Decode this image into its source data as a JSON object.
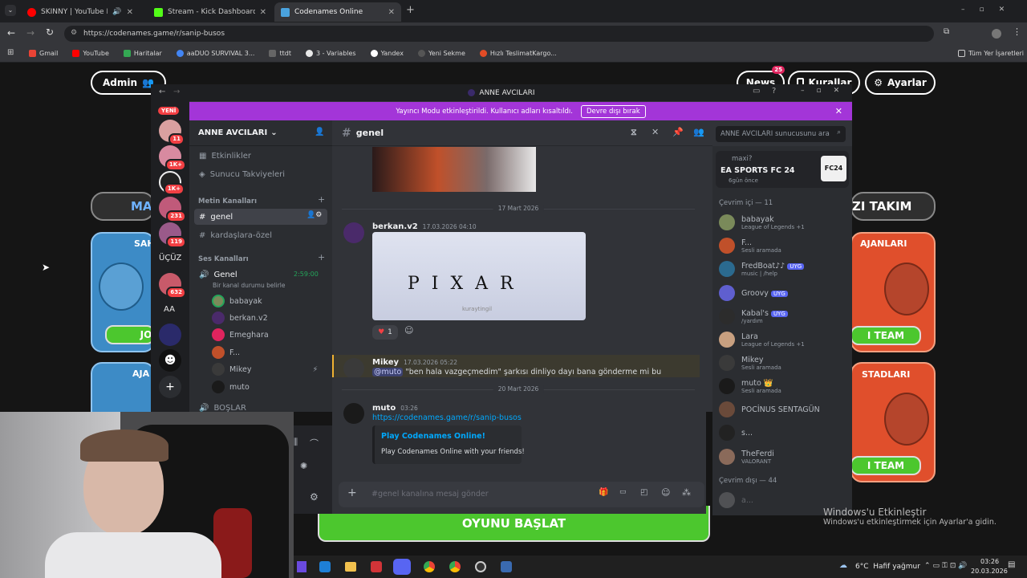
{
  "browser": {
    "tabs": [
      {
        "title": "SKINNY | YouTube Music",
        "color": "#ff0000"
      },
      {
        "title": "Stream - Kick Dashboard",
        "color": "#53fc18"
      },
      {
        "title": "Codenames Online",
        "color": "#4aa3df"
      }
    ],
    "url": "https://codenames.game/r/sanip-busos",
    "bookmarks": [
      {
        "label": "Gmail",
        "color": "#ea4335"
      },
      {
        "label": "YouTube",
        "color": "#ff0000"
      },
      {
        "label": "Haritalar",
        "color": "#34a853"
      },
      {
        "label": "aaDUO SURVIVAL 3...",
        "color": "#4285f4"
      },
      {
        "label": "ttdt",
        "color": "#666666"
      },
      {
        "label": "3 - Variables",
        "color": "#e8e8e8"
      },
      {
        "label": "Yandex",
        "color": "#ffffff"
      },
      {
        "label": "Yeni Sekme",
        "color": "#555555"
      },
      {
        "label": "Hızlı TeslimatKargo...",
        "color": "#e34c26"
      }
    ],
    "all_bookmarks": "Tüm Yer İşaretleri"
  },
  "game": {
    "admin_label": "Admin",
    "news_label": "News",
    "news_count": "25",
    "rules_label": "Kurallar",
    "settings_label": "Ayarlar",
    "left_team_label": "MA",
    "right_team_label": "ZI TAKIM",
    "left_card_header": "SAH",
    "left_join": "JO",
    "left_agents": "AJA",
    "right_agents": "AJANLARI",
    "right_team_btn": "I TEAM",
    "right_spymaster": "STADLARI",
    "right_team_btn2": "I TEAM",
    "start_button": "OYUNU BAŞLAT"
  },
  "discord": {
    "window_title": "ANNE AVCILARI",
    "banner_text": "Yayıncı Modu etkinleştirildi. Kullanıcı adları kısaltıldı.",
    "banner_button": "Devre dışı bırak",
    "server_new_label": "YENİ",
    "server_badges": [
      "11",
      "1K+",
      "1K+",
      "231",
      "119",
      "632"
    ],
    "server_text_icons": [
      "ÜÇÜZ",
      "AA"
    ],
    "server_name": "ANNE AVCILARI",
    "channels": {
      "events": "Etkinlikler",
      "boosts": "Sunucu Takviyeleri",
      "text_category": "Metin Kanalları",
      "general": "genel",
      "friends": "kardaşlara-özel",
      "voice_category": "Ses Kanalları",
      "voice_channel": "Genel",
      "voice_timer": "2:59:00",
      "voice_status": "Bir kanal durumu belirle",
      "voice_users": [
        "babayak",
        "berkan.v2",
        "Emeghara",
        "F...",
        "Mikey",
        "muto"
      ],
      "next_channel": "BOŞLAR"
    },
    "chat": {
      "channel": "genel",
      "search_placeholder": "ANNE AVCILARI sunucusunu ara",
      "date1": "17 Mart 2026",
      "msg1_user": "berkan.v2",
      "msg1_time": "17.03.2026 04:10",
      "msg1_image_text": "P I X A R",
      "msg1_image_caption": "kuraytingil",
      "msg1_reaction": "1",
      "msg2_user": "Mikey",
      "msg2_time": "17.03.2026 05:22",
      "msg2_mention": "@muto",
      "msg2_text": "\"ben hala vazgeçmedim\" şarkısı dinliyo dayı bana gönderme mi bu",
      "date2": "20 Mart 2026",
      "msg3_user": "muto",
      "msg3_time": "03:26",
      "msg3_link": "https://codenames.game/r/sanip-busos",
      "embed_title": "Play Codenames Online!",
      "embed_desc": "Play Codenames Online with your friends!",
      "composer_placeholder": "#genel kanalına mesaj gönder"
    },
    "activity": {
      "user": "maxi?",
      "game": "EA SPORTS FC 24",
      "ago": "6gün önce",
      "logo": "FC24"
    },
    "online_header": "Çevrim içi — 11",
    "members": [
      {
        "name": "babayak",
        "status": "League of Legends +1",
        "color": "#7a8a5a"
      },
      {
        "name": "F...",
        "status": "Sesli aramada",
        "color": "#c0502a"
      },
      {
        "name": "FredBoat♪♪",
        "status": "music | /help",
        "color": "#2b6a8f",
        "tag": "UYG"
      },
      {
        "name": "Groovy",
        "status": "",
        "color": "#5f5fcf",
        "tag": "UYG"
      },
      {
        "name": "Kabal's",
        "status": "/yardım",
        "color": "#2c2c2c",
        "tag": "UYG"
      },
      {
        "name": "Lara",
        "status": "League of Legends +1",
        "color": "#c8a080"
      },
      {
        "name": "Mikey",
        "status": "Sesli aramada",
        "color": "#3a3a3a"
      },
      {
        "name": "muto 👑",
        "status": "Sesli aramada",
        "color": "#1a1a1a"
      },
      {
        "name": "POCİNUS SENTAGÜN",
        "status": "",
        "color": "#6a4a3a"
      },
      {
        "name": "s...",
        "status": "",
        "color": "#222222"
      },
      {
        "name": "TheFerdi",
        "status": "VALORANT",
        "color": "#8a6a5a"
      }
    ],
    "offline_header": "Çevrim dışı — 44",
    "offline_first": "a..."
  },
  "windows": {
    "activate_title": "Windows'u Etkinleştir",
    "activate_sub": "Windows'u etkinleştirmek için Ayarlar'a gidin.",
    "weather": "6°C  Hafif yağmur",
    "time": "03:26",
    "date": "20.03.2026"
  }
}
